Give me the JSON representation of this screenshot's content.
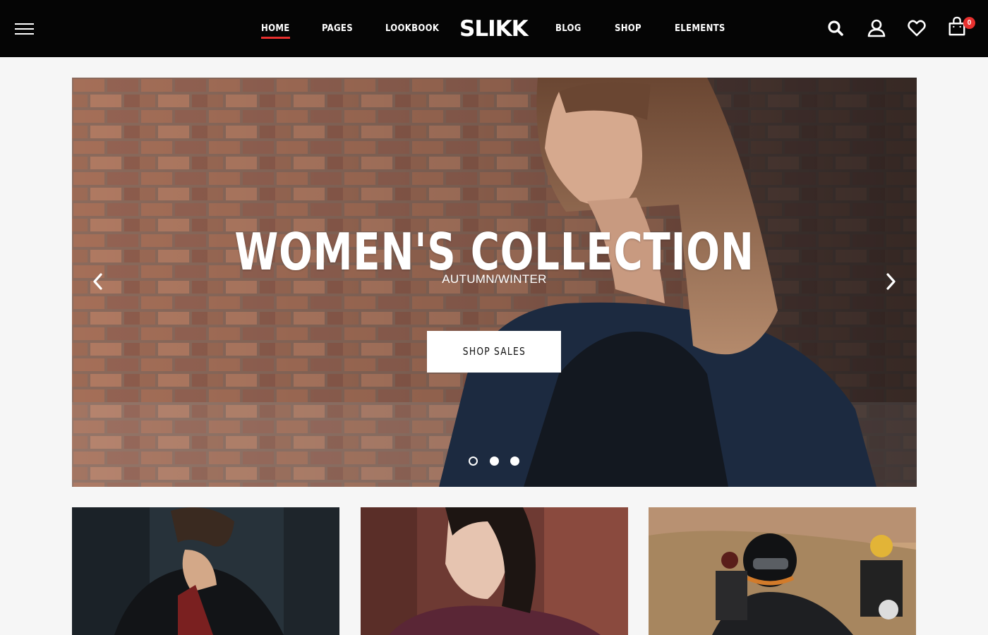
{
  "header": {
    "logo": "SLIKK",
    "nav": {
      "home": "HOME",
      "pages": "PAGES",
      "lookbook": "LOOKBOOK",
      "blog": "BLOG",
      "shop": "SHOP",
      "elements": "ELEMENTS"
    },
    "active_nav": "HOME",
    "cart_count": "0",
    "icons": [
      "menu-icon",
      "search-icon",
      "user-icon",
      "heart-icon",
      "cart-icon"
    ],
    "colors": {
      "background": "#050505",
      "accent": "#e8302e"
    }
  },
  "hero": {
    "subtitle": "AUTUMN/WINTER",
    "title": "WOMEN'S COLLECTION",
    "button_label": "SHOP SALES",
    "slides": 3,
    "active_slide": 1
  }
}
